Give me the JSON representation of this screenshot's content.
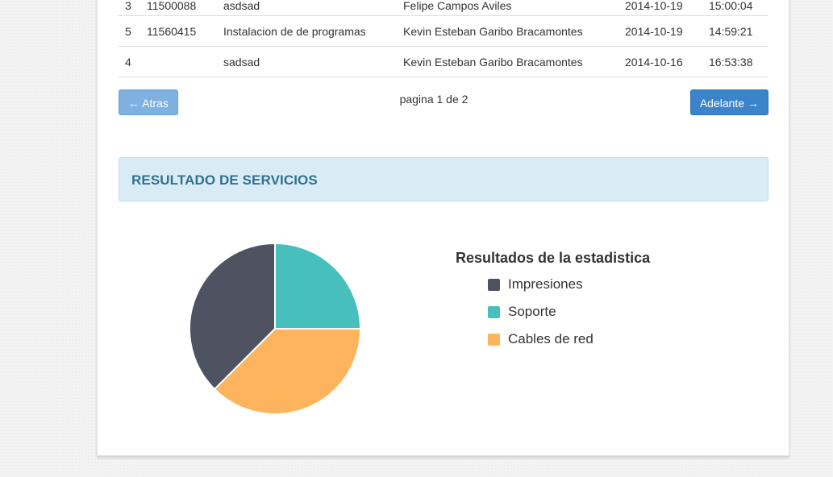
{
  "table": {
    "rows": [
      {
        "num": "3",
        "code": "11500088",
        "desc": "asdsad",
        "user": "Felipe Campos Aviles",
        "date": "2014-10-19",
        "time": "15:00:04"
      },
      {
        "num": "5",
        "code": "11560415",
        "desc": "Instalacion de de programas",
        "user": "Kevin Esteban Garibo Bracamontes",
        "date": "2014-10-19",
        "time": "14:59:21"
      },
      {
        "num": "4",
        "code": "",
        "desc": "sadsad",
        "user": "Kevin Esteban Garibo Bracamontes",
        "date": "2014-10-16",
        "time": "16:53:38"
      }
    ]
  },
  "pagination": {
    "back_label": "← Atras",
    "next_label": "Adelante →",
    "page_info": "pagina 1 de 2"
  },
  "section": {
    "title": "RESULTADO DE SERVICIOS"
  },
  "chart_data": {
    "type": "pie",
    "title": "Resultados de la estadistica",
    "categories": [
      "Impresiones",
      "Soporte",
      "Cables de red"
    ],
    "values": [
      3,
      2,
      3
    ],
    "colors": [
      "#4d5360",
      "#46bfbd",
      "#fdb45c"
    ],
    "legend_position": "right"
  }
}
